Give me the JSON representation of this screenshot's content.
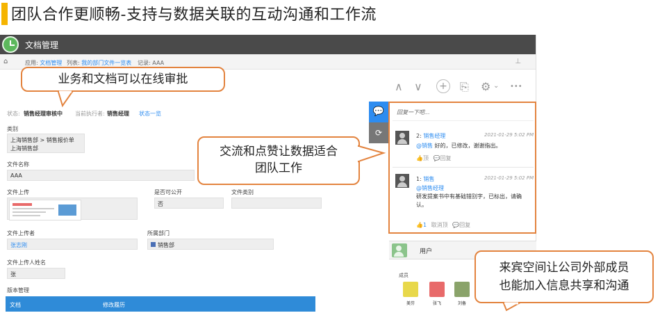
{
  "slide": {
    "heading": "团队合作更顺畅-支持与数据关联的互动沟通和工作流"
  },
  "app": {
    "title": "文档管理",
    "breadcrumb": {
      "app_label": "应用:",
      "app_value": "文档管理",
      "list_label": "列表:",
      "list_value": "我的部门文件一览表",
      "record_label": "记录:",
      "record_value": "AAA"
    }
  },
  "toolbar": {
    "up": "∧",
    "down": "∨",
    "add": "+",
    "copy": "⎘",
    "settings": "⚙",
    "settings_arrow": "⌄",
    "more": "•••"
  },
  "form": {
    "status_label": "状态:",
    "status_value": "销售经理审核中",
    "executor_label": "当前执行者:",
    "executor_value": "销售经理",
    "status_list_link": "状态一览",
    "category_label": "类别",
    "category_lines": [
      "上海销售部 > 销售报价单",
      "上海销售部"
    ],
    "filename_label": "文件名称",
    "filename_value": "AAA",
    "upload_label": "文件上传",
    "public_label": "是否可公开",
    "public_value": "否",
    "filetype_label": "文件类别",
    "filetype_value": "",
    "uploader_label": "文件上传者",
    "uploader_value": "张志刚",
    "dept_label": "所属部门",
    "dept_value": "销售部",
    "uploader_name_label": "文件上传人姓名",
    "uploader_name_value": "张",
    "version_label": "版本管理",
    "table_col1": "文档",
    "table_col2": "修改履历"
  },
  "comments": {
    "reply_placeholder": "回复一下吧...",
    "items": [
      {
        "index": "2:",
        "author": "销售经理",
        "time": "2021-01-29 5:02 PM",
        "mention": "@销售",
        "text": "好的，已修改，谢谢指出。",
        "like_label": "顶",
        "reply_label": "回复"
      },
      {
        "index": "1:",
        "author": "销售",
        "time": "2021-01-29 5:02 PM",
        "mention": "@销售经理",
        "text": "研发提案书中有基础错别字，已标出，请确认。",
        "like_count": "1",
        "unlike_label": "取消顶",
        "reply_label": "回复"
      }
    ]
  },
  "users": {
    "title": "用户",
    "members_label": "成员",
    "members": [
      {
        "name": "美芬",
        "color": "#e8d84a"
      },
      {
        "name": "张飞",
        "color": "#e86a6a"
      },
      {
        "name": "刘备",
        "color": "#8aa36a"
      }
    ]
  },
  "callouts": {
    "approval": "业务和文档可以在线审批",
    "comments_line1": "交流和点赞让数据适合",
    "comments_line2": "团队工作",
    "guests_line1": "来宾空间让公司外部成员",
    "guests_line2": "也能加入信息共享和沟通"
  }
}
